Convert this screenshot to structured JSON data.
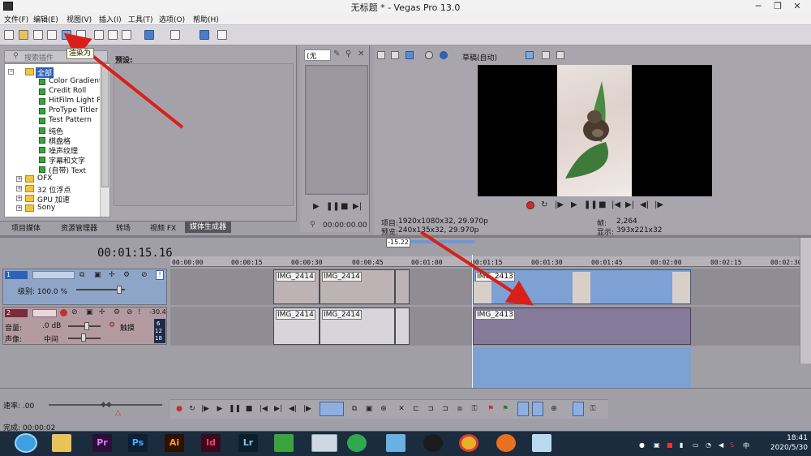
{
  "window": {
    "title": "无标题 * - Vegas Pro 13.0",
    "minimize": "─",
    "maximize": "❐",
    "close": "✕"
  },
  "menu": [
    "文件(F)",
    "编辑(E)",
    "视图(V)",
    "插入(I)",
    "工具(T)",
    "选项(O)",
    "帮助(H)"
  ],
  "toolbar": {
    "tooltip": "渲染为"
  },
  "media_generators": {
    "search_placeholder": "搜索插件",
    "tree": [
      {
        "label": "全部",
        "kind": "folder",
        "selected": true
      },
      {
        "label": "Color Gradient",
        "kind": "plugin"
      },
      {
        "label": "Credit Roll",
        "kind": "plugin"
      },
      {
        "label": "HitFilm Light Fla",
        "kind": "plugin"
      },
      {
        "label": "ProType Titler",
        "kind": "plugin"
      },
      {
        "label": "Test Pattern",
        "kind": "plugin"
      },
      {
        "label": "纯色",
        "kind": "plugin"
      },
      {
        "label": "棋盘格",
        "kind": "plugin"
      },
      {
        "label": "噪声纹理",
        "kind": "plugin"
      },
      {
        "label": "字幕和文字",
        "kind": "plugin"
      },
      {
        "label": "(自带) Text",
        "kind": "plugin"
      },
      {
        "label": "OFX",
        "kind": "folder"
      },
      {
        "label": "32 位浮点",
        "kind": "folder"
      },
      {
        "label": "GPU 加速",
        "kind": "folder"
      },
      {
        "label": "Sony",
        "kind": "folder"
      }
    ],
    "presets_label": "预设:",
    "tabs": [
      "项目媒体",
      "资源管理器",
      "转场",
      "视频 FX",
      "媒体生成器"
    ]
  },
  "trimmer": {
    "select_value": "(无",
    "timecode": "00:00:00.00"
  },
  "preview": {
    "quality": "草稿(自动)",
    "project_label": "项目:",
    "project_value": "1920x1080x32, 29.970p",
    "preview_label": "预览:",
    "preview_value": "240x135x32, 29.970p",
    "frame_label": "帧:",
    "frame_value": "2,264",
    "display_label": "显示:",
    "display_value": "393x221x32"
  },
  "timeline": {
    "timecode": "00:01:15.16",
    "marker": "-15.22",
    "ruler": [
      "00:00:00",
      "00:00:15",
      "00:00:30",
      "00:00:45",
      "00:01:00",
      "00:01:15",
      "00:01:30",
      "00:01:45",
      "00:02:00",
      "00:02:15",
      "00:02:30"
    ],
    "video_track": {
      "number": "1",
      "level_label": "级别: 100.0 %"
    },
    "audio_track": {
      "number": "2",
      "volume_label": "音量:",
      "volume_value": ".0 dB",
      "pan_label": "声像:",
      "pan_value": "中间",
      "touch": "触摸",
      "meter": "-30.4",
      "meter_marks": [
        "6",
        "12",
        "18"
      ]
    },
    "clips": {
      "v1": "IMG_2414",
      "v2": "IMG_2414",
      "v4": "IMG_2413",
      "a1": "IMG_2414",
      "a2": "IMG_2414",
      "a4": "IMG_2413"
    },
    "rate": "速率: .00"
  },
  "status": {
    "text": "完成: 00:00:02"
  },
  "taskbar": {
    "apps": [
      "Pr",
      "Ps",
      "Ai",
      "Id",
      "Lr"
    ],
    "time": "18:41",
    "date": "2020/5/30"
  }
}
